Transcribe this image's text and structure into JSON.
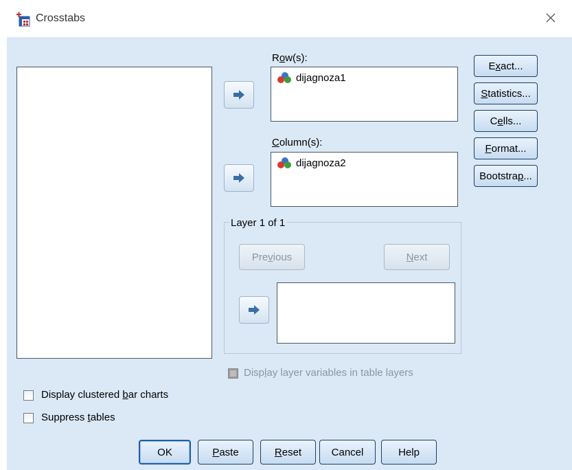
{
  "window": {
    "title": "Crosstabs",
    "icon": "crosstabs-table-icon",
    "close_icon": "close-icon"
  },
  "source_list": {
    "items": []
  },
  "rows": {
    "label_pre": "R",
    "label_ul": "o",
    "label_post": "w(s):",
    "items": [
      {
        "name": "dijagnoza1",
        "icon": "nominal-variable-icon"
      }
    ]
  },
  "columns": {
    "label_pre": "",
    "label_ul": "C",
    "label_post": "olumn(s):",
    "items": [
      {
        "name": "dijagnoza2",
        "icon": "nominal-variable-icon"
      }
    ]
  },
  "layer": {
    "title": "Layer 1 of 1",
    "previous": {
      "pre": "Pre",
      "ul": "v",
      "post": "ious"
    },
    "next": {
      "pre": "",
      "ul": "N",
      "post": "ext"
    },
    "display_option": {
      "pre": "Disp",
      "ul": "l",
      "post": "ay layer variables in table layers",
      "checked": true,
      "enabled": false
    }
  },
  "side_buttons": [
    {
      "pre": "E",
      "ul": "x",
      "post": "act..."
    },
    {
      "pre": "",
      "ul": "S",
      "post": "tatistics..."
    },
    {
      "pre": "C",
      "ul": "e",
      "post": "lls..."
    },
    {
      "pre": "",
      "ul": "F",
      "post": "ormat..."
    },
    {
      "pre": "Bootstra",
      "ul": "p",
      "post": "..."
    }
  ],
  "options": {
    "clustered": {
      "pre": "Display clustered ",
      "ul": "b",
      "post": "ar charts",
      "checked": false
    },
    "suppress": {
      "pre": "Suppress ",
      "ul": "t",
      "post": "ables",
      "checked": false
    }
  },
  "bottom_buttons": {
    "ok": {
      "label": "OK"
    },
    "paste": {
      "pre": "",
      "ul": "P",
      "post": "aste"
    },
    "reset": {
      "pre": "",
      "ul": "R",
      "post": "eset"
    },
    "cancel": {
      "label": "Cancel"
    },
    "help": {
      "label": "Help"
    }
  },
  "colors": {
    "dialog_bg": "#dbe8f5",
    "button_border": "#1b3f66",
    "default_border": "#1f5ea8",
    "disabled_text": "#8a96a3"
  }
}
